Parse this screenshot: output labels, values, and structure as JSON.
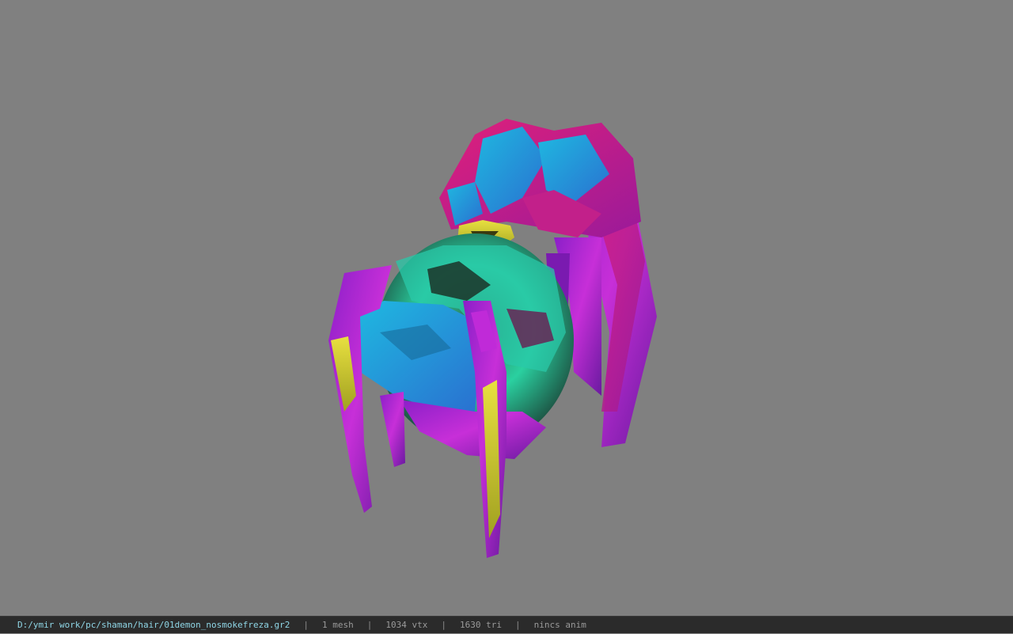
{
  "viewer": {
    "background_color": "#808080",
    "model_icon": "spider-model-icon"
  },
  "statusbar": {
    "file_path": "D:/ymir work/pc/shaman/hair/01demon_nosmokefreza.gr2",
    "separator": "|",
    "mesh_count": "1 mesh",
    "vertex_count": "1034 vtx",
    "triangle_count": "1630 tri",
    "anim_status": "nincs anim",
    "path_color": "#8fd6e6",
    "stat_color": "#9a9a9a"
  }
}
